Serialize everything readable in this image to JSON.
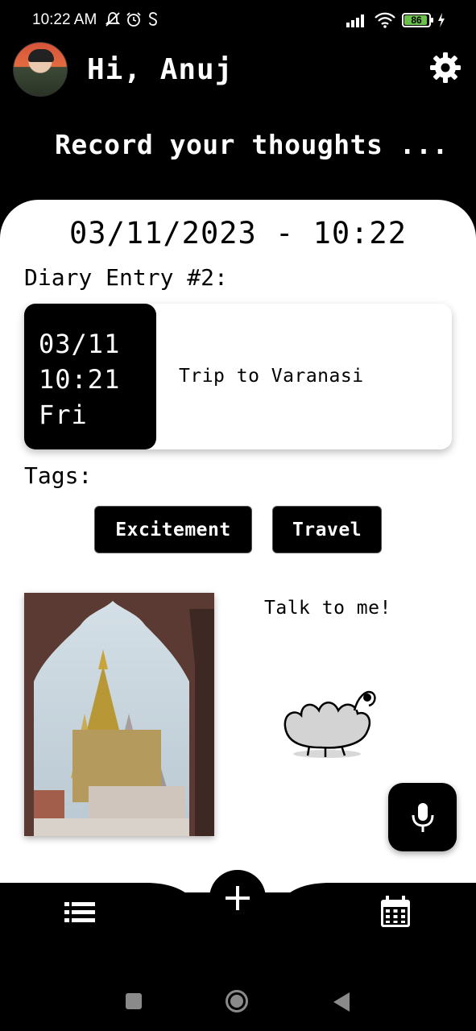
{
  "status_bar": {
    "time": "10:22 AM",
    "battery": "86",
    "icons_left": [
      "mute-icon",
      "alarm-icon",
      "sync-icon"
    ],
    "icons_right": [
      "signal-icon",
      "wifi-icon",
      "battery-icon",
      "charging-icon"
    ]
  },
  "header": {
    "greeting": "Hi, Anuj",
    "tagline": "Record your thoughts ..."
  },
  "card": {
    "datetime": "03/11/2023 - 10:22",
    "entry_label": "Diary Entry #2:",
    "entry": {
      "date": "03/11",
      "time": "10:21",
      "day": "Fri",
      "title": "Trip to Varanasi"
    },
    "tags_label": "Tags:",
    "tags": [
      "Excitement",
      "Travel"
    ],
    "talk_label": "Talk to me!"
  },
  "colors": {
    "background": "#000000",
    "card": "#ffffff",
    "battery": "#6bc04b"
  }
}
